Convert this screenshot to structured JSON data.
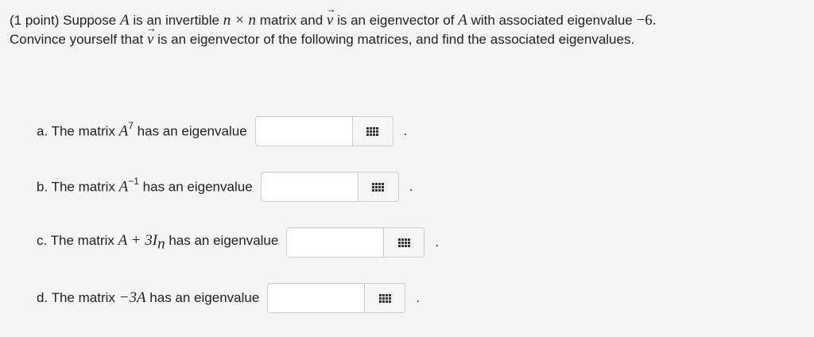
{
  "problem": {
    "points": "(1 point)",
    "intro_a": "Suppose",
    "var_A": "A",
    "intro_b": "is an invertible",
    "dim": "n × n",
    "intro_c": "matrix and",
    "vec_v": "v",
    "intro_d": "is an eigenvector of",
    "intro_e": "with associated eigenvalue",
    "eigenvalue": "−6.",
    "line2_a": "Convince yourself that",
    "line2_b": "is an eigenvector of the following matrices, and find the associated eigenvalues."
  },
  "parts": [
    {
      "prefix": "a. The matrix",
      "math": "A",
      "sup": "7",
      "suffix": "has an eigenvalue",
      "value": "",
      "period": "."
    },
    {
      "prefix": "b. The matrix",
      "math": "A",
      "sup": "−1",
      "suffix": "has an eigenvalue",
      "value": "",
      "period": "."
    },
    {
      "prefix": "c. The matrix",
      "math": "A + 3I",
      "sub": "n",
      "suffix": "has an eigenvalue",
      "value": "",
      "period": "."
    },
    {
      "prefix": "d. The matrix",
      "math": "−3A",
      "suffix": "has an eigenvalue",
      "value": "",
      "period": "."
    }
  ],
  "icons": {
    "matrix_button": "grid-icon"
  }
}
